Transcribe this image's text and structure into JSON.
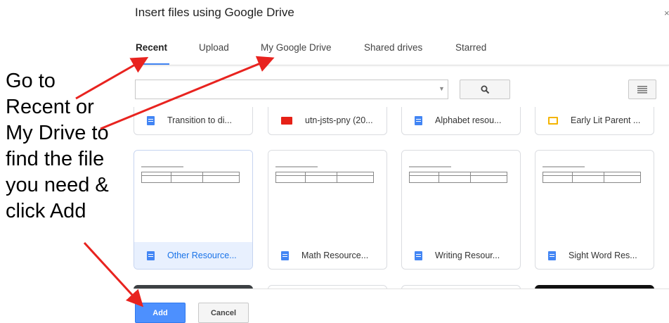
{
  "dialog": {
    "title": "Insert files using Google Drive",
    "close_glyph": "×"
  },
  "tabs": [
    {
      "label": "Recent",
      "active": true
    },
    {
      "label": "Upload",
      "active": false
    },
    {
      "label": "My Google Drive",
      "active": false
    },
    {
      "label": "Shared drives",
      "active": false
    },
    {
      "label": "Starred",
      "active": false
    }
  ],
  "search": {
    "value": "",
    "dropdown_glyph": "▼",
    "icon": "search-icon"
  },
  "view_toggle": {
    "icon": "list-view-icon"
  },
  "files_row1": [
    {
      "name": "Transition to di...",
      "type": "doc"
    },
    {
      "name": "utn-jsts-pny (20...",
      "type": "video"
    },
    {
      "name": "Alphabet resou...",
      "type": "doc"
    },
    {
      "name": "Early Lit Parent ...",
      "type": "slides"
    }
  ],
  "files_row2": [
    {
      "name": "Other Resource...",
      "type": "doc",
      "selected": true
    },
    {
      "name": "Math Resource...",
      "type": "doc",
      "selected": false
    },
    {
      "name": "Writing Resour...",
      "type": "doc",
      "selected": false
    },
    {
      "name": "Sight Word Res...",
      "type": "doc",
      "selected": false
    }
  ],
  "buttons": {
    "add": "Add",
    "cancel": "Cancel"
  },
  "annotation": {
    "lines": [
      "Go to",
      "Recent or",
      "My Drive to",
      "find the file",
      "you need &",
      "click Add"
    ],
    "arrow_color": "#e8231f"
  },
  "colors": {
    "accent": "#4285f4",
    "primary_button": "#4d90fe"
  }
}
